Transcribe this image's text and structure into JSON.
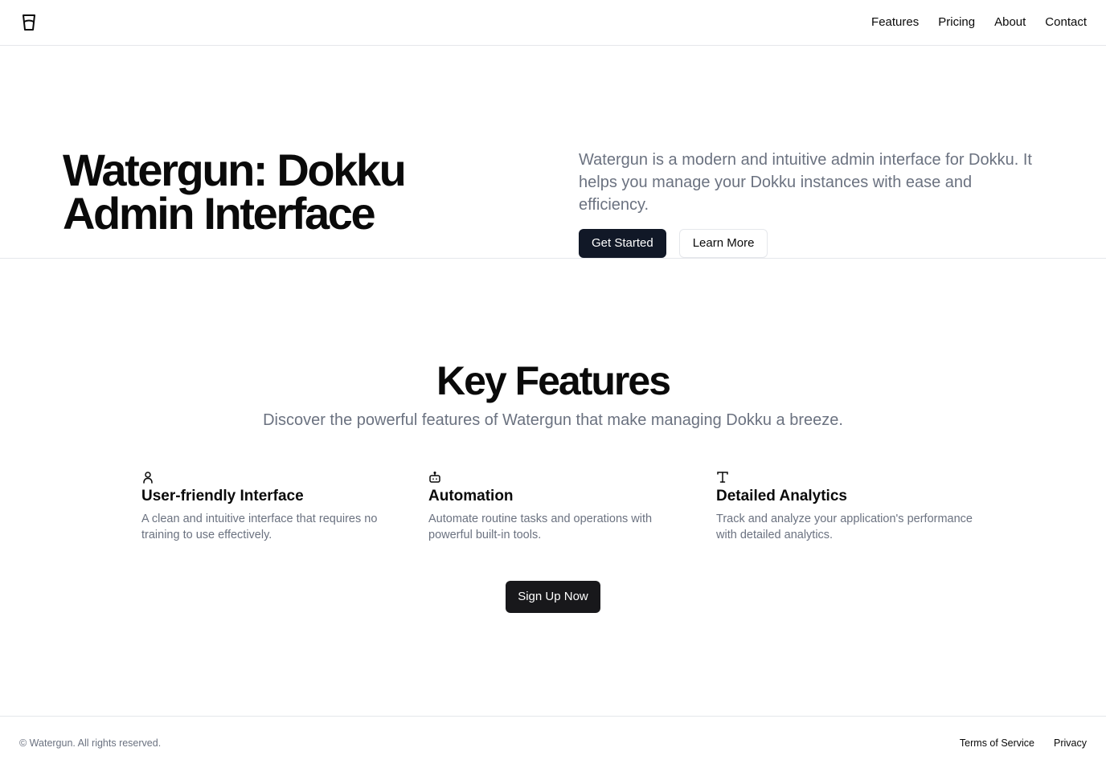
{
  "header": {
    "logo_icon": "glass-icon",
    "nav": [
      {
        "label": "Features"
      },
      {
        "label": "Pricing"
      },
      {
        "label": "About"
      },
      {
        "label": "Contact"
      }
    ]
  },
  "hero": {
    "title": "Watergun: Dokku Admin Interface",
    "description": "Watergun is a modern and intuitive admin interface for Dokku. It helps you manage your Dokku instances with ease and efficiency.",
    "primary_button": "Get Started",
    "secondary_button": "Learn More"
  },
  "features": {
    "title": "Key Features",
    "subtitle": "Discover the powerful features of Watergun that make managing Dokku a breeze.",
    "items": [
      {
        "icon": "user-icon",
        "title": "User-friendly Interface",
        "description": "A clean and intuitive interface that requires no training to use effectively."
      },
      {
        "icon": "bot-icon",
        "title": "Automation",
        "description": "Automate routine tasks and operations with powerful built-in tools."
      },
      {
        "icon": "type-icon",
        "title": "Detailed Analytics",
        "description": "Track and analyze your application's performance with detailed analytics."
      }
    ],
    "cta": "Sign Up Now"
  },
  "footer": {
    "copyright": "© Watergun. All rights reserved.",
    "links": [
      {
        "label": "Terms of Service"
      },
      {
        "label": "Privacy"
      }
    ]
  },
  "colors": {
    "primary_button": "#111827",
    "signup_button": "#18181b",
    "muted_text": "#6b7280",
    "border": "#e5e7eb"
  }
}
